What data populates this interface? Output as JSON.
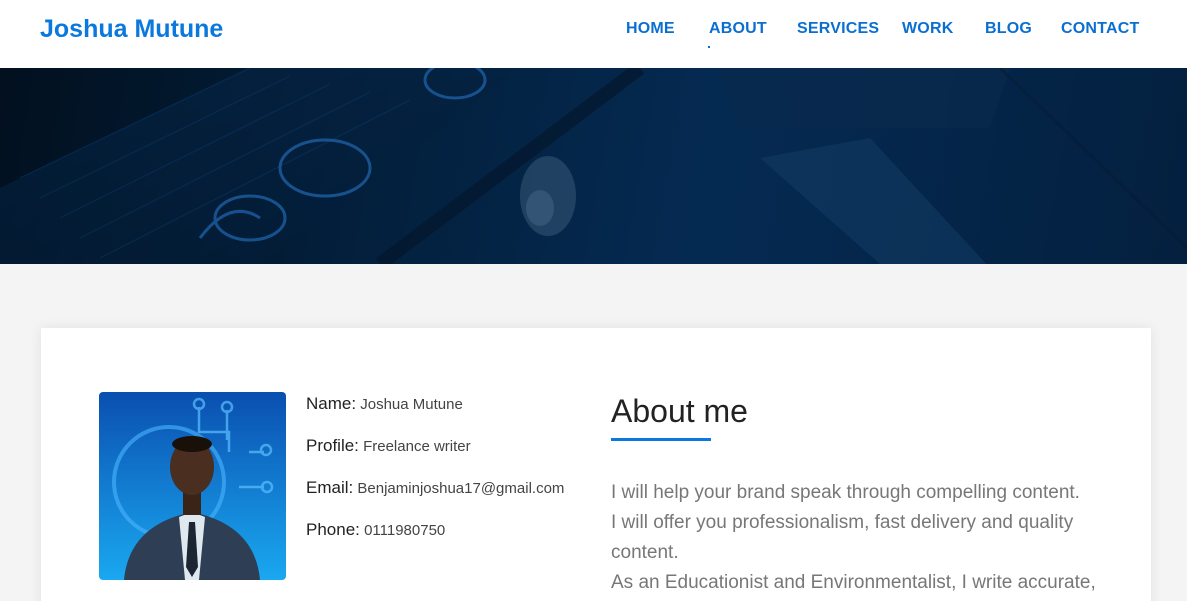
{
  "brand": "Joshua Mutune",
  "nav": {
    "items": [
      "HOME",
      "ABOUT",
      "SERVICES",
      "WORK",
      "BLOG",
      "CONTACT"
    ],
    "active": "ABOUT"
  },
  "colors": {
    "accent": "#0b78de",
    "hero": "#03213f",
    "background": "#f4f4f4"
  },
  "profile": {
    "name_label": "Name:",
    "name_value": "Joshua Mutune",
    "profile_label": "Profile:",
    "profile_value": "Freelance writer",
    "email_label": "Email:",
    "email_value": "Benjaminjoshua17@gmail.com",
    "phone_label": "Phone:",
    "phone_value": "0111980750"
  },
  "about": {
    "title": "About me",
    "lines": [
      "I will help your brand speak through compelling content.",
      "I will offer you professionalism, fast delivery and quality content.",
      "As an Educationist and Environmentalist, I write accurate,"
    ]
  }
}
